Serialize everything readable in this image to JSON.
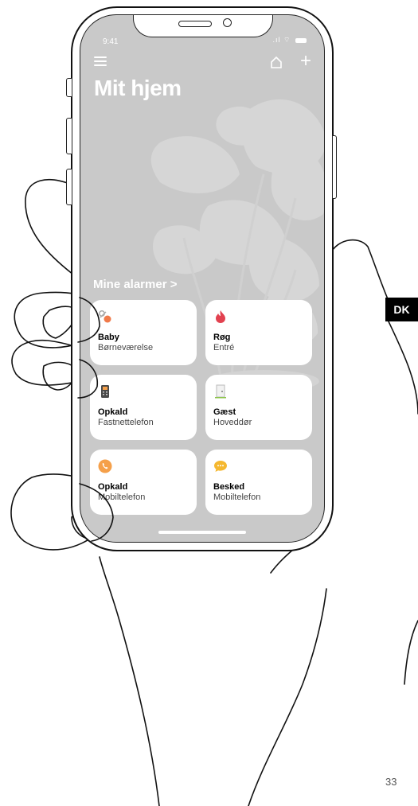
{
  "status_bar": {
    "time": "9:41"
  },
  "header": {
    "title": "Mit hjem"
  },
  "alarms_section": {
    "label": "Mine alarmer >"
  },
  "cards": [
    {
      "name": "Baby",
      "room": "Børneværelse",
      "icon": "pacifier-icon"
    },
    {
      "name": "Røg",
      "room": "Entré",
      "icon": "flame-icon"
    },
    {
      "name": "Opkald",
      "room": "Fastnettelefon",
      "icon": "landline-phone-icon"
    },
    {
      "name": "Gæst",
      "room": "Hoveddør",
      "icon": "door-icon"
    },
    {
      "name": "Opkald",
      "room": "Mobiltelefon",
      "icon": "mobile-call-icon"
    },
    {
      "name": "Besked",
      "room": "Mobiltelefon",
      "icon": "message-bubble-icon"
    }
  ],
  "page": {
    "language_badge": "DK",
    "page_number": "33"
  },
  "colors": {
    "screen_bg": "#c9c9c9",
    "flame": "#e2414f",
    "pacifier": "#f07a4a",
    "call": "#f5a04a",
    "message": "#f5b830",
    "door_accent": "#8bc34a"
  }
}
